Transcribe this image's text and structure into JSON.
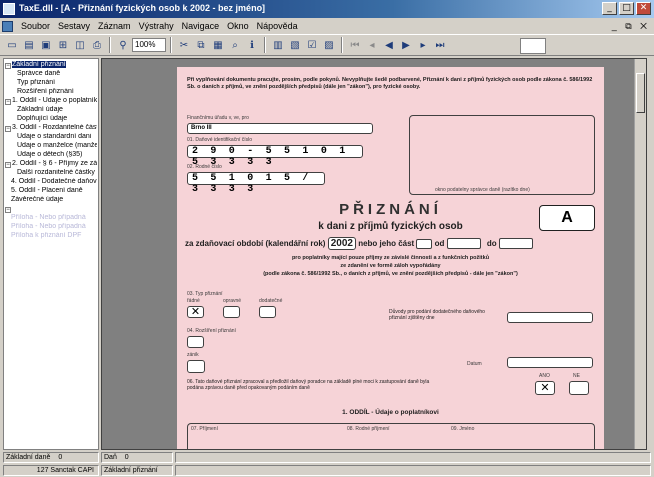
{
  "window": {
    "title": "TaxE.dll - [A - Přiznání fyzických osob k 2002 - bez jméno]",
    "controls": {
      "minimize": "_",
      "maximize": "□",
      "close": "✕"
    },
    "mdi_controls": "_ ⧉ ✕"
  },
  "menu": [
    "Soubor",
    "Sestavy",
    "Záznam",
    "Výstrahy",
    "Navigace",
    "Okno",
    "Nápověda"
  ],
  "toolbar": {
    "zoom": "100%",
    "icons": [
      "new-icon",
      "open-icon",
      "save-icon",
      "save-as-icon",
      "print-preview-icon",
      "print-icon",
      "cut-icon",
      "copy-icon",
      "paste-icon",
      "find-icon",
      "info-icon",
      "calendar-icon",
      "chart-icon",
      "check-icon",
      "form-icon"
    ],
    "nav_icons": [
      "first-icon",
      "prev-page-icon",
      "prev-icon",
      "next-icon",
      "next-page-icon",
      "last-icon"
    ]
  },
  "tree": [
    {
      "label": "Základní přiznání",
      "level": 0,
      "expander": "−",
      "selected": true
    },
    {
      "label": "Správce daně",
      "level": 2
    },
    {
      "label": "Typ přiznání",
      "level": 2
    },
    {
      "label": "Rozšíření přiznání",
      "level": 2
    },
    {
      "label": "1. Oddíl - Údaje o poplatníkovi",
      "level": 0,
      "expander": "−"
    },
    {
      "label": "Základní údaje",
      "level": 2
    },
    {
      "label": "Doplňující údaje",
      "level": 2
    },
    {
      "label": "3. Oddíl - Rozdanitelné částky",
      "level": 0,
      "expander": "−"
    },
    {
      "label": "Údaje o standardní dani",
      "level": 2
    },
    {
      "label": "Údaje o manželce (manželovi)",
      "level": 2
    },
    {
      "label": "Údaje o dětech (§35)",
      "level": 2
    },
    {
      "label": "2. Oddíl - § 6 - Příjmy ze závislé",
      "level": 0,
      "expander": "−"
    },
    {
      "label": "Další rozdanitelné částky",
      "level": 2
    },
    {
      "label": "4. Oddíl - Dodatečné daňové",
      "level": 1
    },
    {
      "label": "5. Oddíl - Placení daně",
      "level": 1
    },
    {
      "label": "Závěrečné údaje",
      "level": 1
    },
    {
      "label": "",
      "level": 0,
      "expander": "−"
    },
    {
      "label": "Příloha - Nebo případná",
      "level": 1,
      "faded": true
    },
    {
      "label": "Příloha - Nebo případná",
      "level": 1,
      "faded": true
    },
    {
      "label": "Příloha k přiznání DPF",
      "level": 1,
      "faded": true
    }
  ],
  "form": {
    "intro_text": "Při vyplňování dokumentu pracujte, prosím, podle pokynů. Nevyplňujte šedě podbarvené, Přiznání k dani z příjmů fyzických osob podle zákona č. 586/1992 Sb. o daních z příjmů, ve znění pozdějších předpisů (dále jen \"zákon\"), pro fyzické osoby.",
    "tax_office_label": "Finančnímu úřadu v, ve, pro",
    "tax_office_value": "Brno III",
    "dic_label": "01. Daňové identifikační číslo",
    "dic_value": "2 9 0 - 5 5 1 0 1 5 3 3 3 3",
    "birth_label": "02. Rodné číslo",
    "birth_value": "5 5 1 0 1 5 / 3 3 3 3",
    "stamp_caption": "okno podatelny správce daně (razítko dne)",
    "main_title": "PŘIZNÁNÍ",
    "sub_title": "k dani z příjmů fyzických osob",
    "form_letter": "A",
    "period_prefix": "za zdaňovací období (kalendářní rok)",
    "period_year": "2002",
    "period_mid": "nebo jeho část",
    "period_od": "od",
    "period_do": "do",
    "note_line1": "pro poplatníky mající pouze příjmy ze závislé činnosti a z funkčních požitků",
    "note_line2": "ze zdanění ve formě záloh vypořádány",
    "note_line3": "(podle zákona č. 586/1992 Sb., o daních z příjmů, ve znění pozdějších předpisů - dále jen \"zákon\")",
    "type_label": "03. Typ přiznání",
    "type_options": [
      "řádné",
      "opravné",
      "dodatečné"
    ],
    "reason_label": "04. Rozšíření přiznání",
    "reason_right_label": "Důvody pro podání dodatečného daňového přiznání zjištěny dne",
    "date_label": "Datum",
    "zbox_label": "zánik",
    "q06_label": "06. Tato daňové přiznání zpracoval a předložil daňový poradce na základě plné moci k zastupování daně byla podána zprávou daně před opakovaným podáním daně",
    "yes": "ANO",
    "no": "NE",
    "section_title": "1. ODDÍL - Údaje o poplatníkovi",
    "cols": [
      "07. Příjmení",
      "08. Rodné příjmení",
      "09. Jméno"
    ]
  },
  "status": {
    "a_label": "Základní daně",
    "a_value": "0",
    "b_label": "Daň",
    "b_value": "0",
    "c_label": "127 Sanctak CAPI",
    "d_label": "Základní přiznání"
  }
}
